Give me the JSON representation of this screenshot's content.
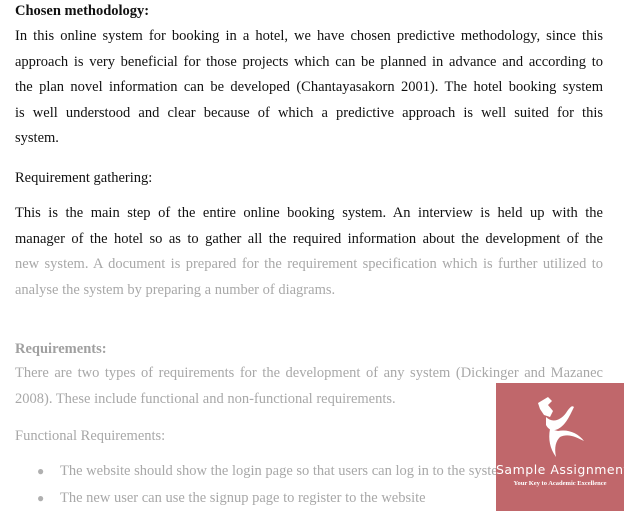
{
  "document": {
    "section1": {
      "heading": "Chosen methodology:",
      "lines": [
        "In this online system for booking in a hotel, we have chosen predictive methodology, since this",
        "approach is very beneficial for those projects which can be planned in advance and according to",
        "the plan novel information can be developed (Chantayasakorn 2001). The hotel booking system",
        "is well understood and clear because of which a predictive approach is well suited for this",
        "system."
      ]
    },
    "section2": {
      "heading": "Requirement gathering:",
      "lines": [
        "This is the main step of the entire online booking system. An interview is held up with the",
        "manager of the hotel so as to gather all the required information about the development of the",
        "new system. A document is prepared for the requirement specification which is further utilized to",
        "analyse the system by preparing a number of diagrams."
      ]
    },
    "section3": {
      "heading": "Requirements:",
      "lines": [
        "There are two types of requirements for the development of any system (Dickinger and Mazanec",
        "2008). These include functional and non-functional requirements."
      ]
    },
    "section4": {
      "heading": "Functional Requirements:",
      "bullet_glyph": "●",
      "bullets": [
        "The website should show the login page so that users can log in to the system",
        "The new user can use the signup page to register to the website"
      ]
    }
  },
  "watermark": {
    "brand": "Sample Assignment",
    "tagline": "Your Key to Academic Excellence",
    "icon": "running-figure-logo-icon",
    "background_color": "#c0676b"
  }
}
